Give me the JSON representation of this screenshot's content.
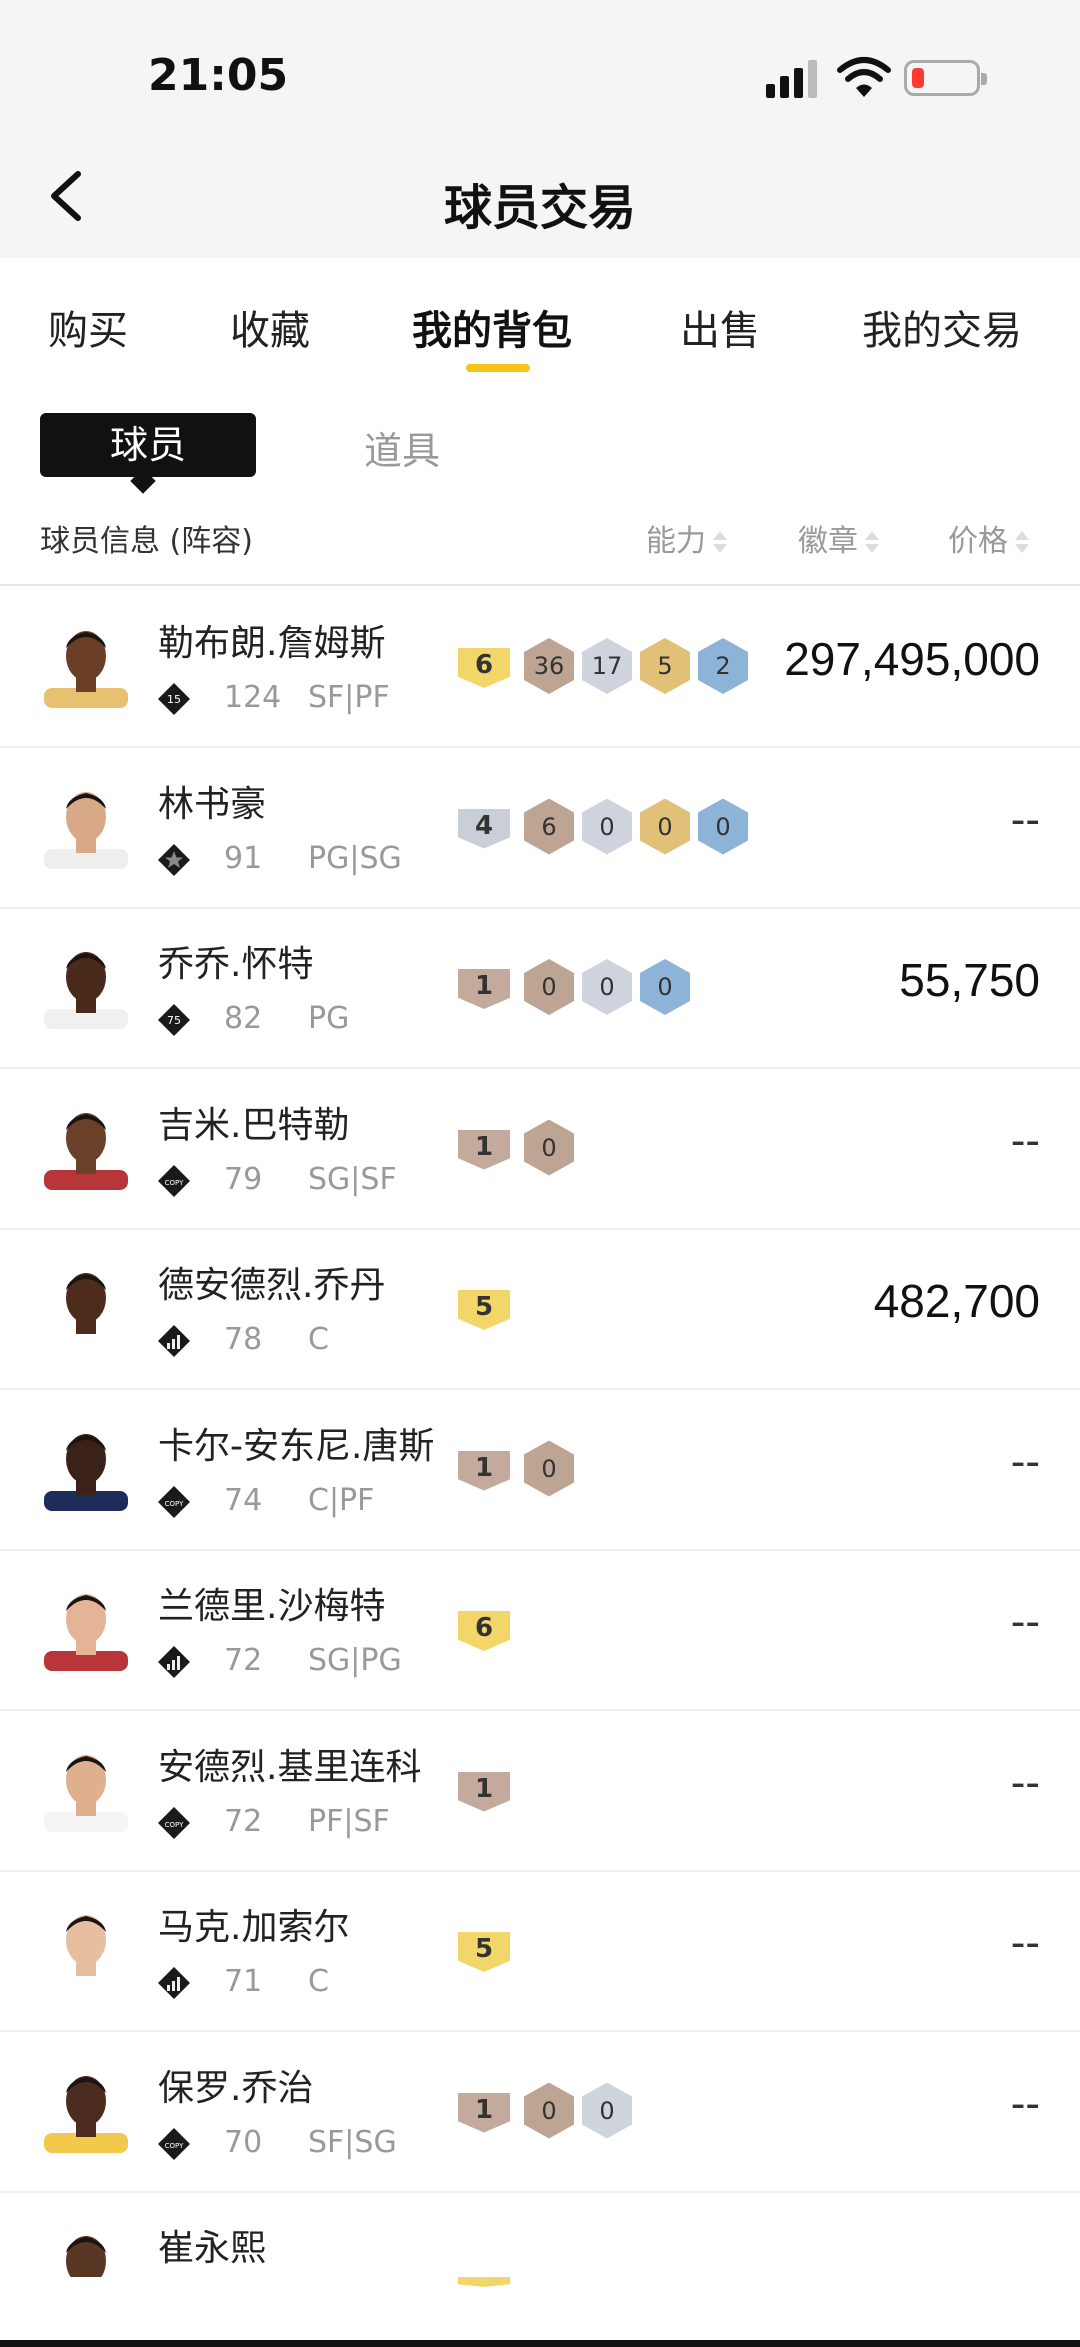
{
  "status_bar": {
    "time": "21:05",
    "icons": [
      "cellular-signal-icon",
      "wifi-icon",
      "battery-low-icon"
    ],
    "battery_color": "#ff3b30"
  },
  "nav": {
    "title": "球员交易",
    "back_icon": "chevron-left-icon"
  },
  "tabs": [
    {
      "label": "购买",
      "active": false
    },
    {
      "label": "收藏",
      "active": false
    },
    {
      "label": "我的背包",
      "active": true
    },
    {
      "label": "出售",
      "active": false
    },
    {
      "label": "我的交易",
      "active": false
    }
  ],
  "accent_color": "#f5c518",
  "segments": {
    "selected": "球员",
    "other": "道具"
  },
  "columns": {
    "info": "球员信息 (阵容)",
    "ability": "能力",
    "badges": "徽章",
    "price": "价格"
  },
  "players": [
    {
      "name": "勒布朗.詹姆斯",
      "tier": "15",
      "ovr": "124",
      "pos": "SF|PF",
      "ability": "6",
      "ability_color": "gold",
      "badges": [
        {
          "v": "36",
          "c": "bronze"
        },
        {
          "v": "17",
          "c": "silver"
        },
        {
          "v": "5",
          "c": "gold"
        },
        {
          "v": "2",
          "c": "blue"
        }
      ],
      "price": "297,495,000"
    },
    {
      "name": "林书豪",
      "tier": "star",
      "ovr": "91",
      "pos": "PG|SG",
      "ability": "4",
      "ability_color": "silver",
      "badges": [
        {
          "v": "6",
          "c": "bronze"
        },
        {
          "v": "0",
          "c": "silver"
        },
        {
          "v": "0",
          "c": "gold"
        },
        {
          "v": "0",
          "c": "blue"
        }
      ],
      "price": "--"
    },
    {
      "name": "乔乔.怀特",
      "tier": "75",
      "ovr": "82",
      "pos": "PG",
      "ability": "1",
      "ability_color": "bronze",
      "badges": [
        {
          "v": "0",
          "c": "bronze"
        },
        {
          "v": "0",
          "c": "silver"
        },
        {
          "v": "0",
          "c": "blue"
        }
      ],
      "price": "55,750"
    },
    {
      "name": "吉米.巴特勒",
      "tier": "COPY",
      "ovr": "79",
      "pos": "SG|SF",
      "ability": "1",
      "ability_color": "bronze",
      "badges": [
        {
          "v": "0",
          "c": "bronze"
        }
      ],
      "price": "--"
    },
    {
      "name": "德安德烈.乔丹",
      "tier": "bars",
      "ovr": "78",
      "pos": "C",
      "ability": "5",
      "ability_color": "gold",
      "badges": [],
      "price": "482,700"
    },
    {
      "name": "卡尔-安东尼.唐斯",
      "tier": "COPY",
      "ovr": "74",
      "pos": "C|PF",
      "ability": "1",
      "ability_color": "bronze",
      "badges": [
        {
          "v": "0",
          "c": "bronze"
        }
      ],
      "price": "--"
    },
    {
      "name": "兰德里.沙梅特",
      "tier": "bars",
      "ovr": "72",
      "pos": "SG|PG",
      "ability": "6",
      "ability_color": "gold",
      "badges": [],
      "price": "--"
    },
    {
      "name": "安德烈.基里连科",
      "tier": "COPY",
      "ovr": "72",
      "pos": "PF|SF",
      "ability": "1",
      "ability_color": "bronze",
      "badges": [],
      "price": "--"
    },
    {
      "name": "马克.加索尔",
      "tier": "bars",
      "ovr": "71",
      "pos": "C",
      "ability": "5",
      "ability_color": "gold",
      "badges": [],
      "price": "--"
    },
    {
      "name": "保罗.乔治",
      "tier": "COPY",
      "ovr": "70",
      "pos": "SF|SG",
      "ability": "1",
      "ability_color": "bronze",
      "badges": [
        {
          "v": "0",
          "c": "bronze"
        },
        {
          "v": "0",
          "c": "silver"
        }
      ],
      "price": "--"
    },
    {
      "name": "崔永熙",
      "tier": "",
      "ovr": "",
      "pos": "",
      "ability": "",
      "ability_color": "gold",
      "badges": [],
      "price": ""
    }
  ]
}
